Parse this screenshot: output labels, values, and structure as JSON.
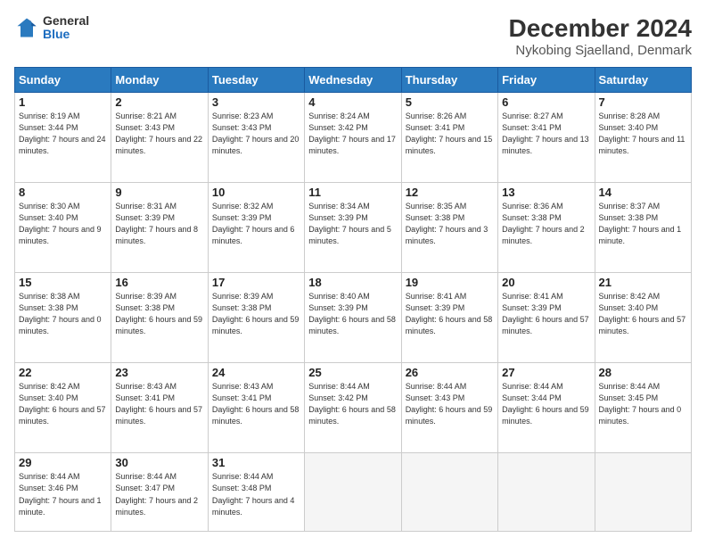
{
  "logo": {
    "general": "General",
    "blue": "Blue"
  },
  "title": "December 2024",
  "location": "Nykobing Sjaelland, Denmark",
  "headers": [
    "Sunday",
    "Monday",
    "Tuesday",
    "Wednesday",
    "Thursday",
    "Friday",
    "Saturday"
  ],
  "weeks": [
    [
      {
        "day": "1",
        "sunrise": "8:19 AM",
        "sunset": "3:44 PM",
        "daylight": "7 hours and 24 minutes."
      },
      {
        "day": "2",
        "sunrise": "8:21 AM",
        "sunset": "3:43 PM",
        "daylight": "7 hours and 22 minutes."
      },
      {
        "day": "3",
        "sunrise": "8:23 AM",
        "sunset": "3:43 PM",
        "daylight": "7 hours and 20 minutes."
      },
      {
        "day": "4",
        "sunrise": "8:24 AM",
        "sunset": "3:42 PM",
        "daylight": "7 hours and 17 minutes."
      },
      {
        "day": "5",
        "sunrise": "8:26 AM",
        "sunset": "3:41 PM",
        "daylight": "7 hours and 15 minutes."
      },
      {
        "day": "6",
        "sunrise": "8:27 AM",
        "sunset": "3:41 PM",
        "daylight": "7 hours and 13 minutes."
      },
      {
        "day": "7",
        "sunrise": "8:28 AM",
        "sunset": "3:40 PM",
        "daylight": "7 hours and 11 minutes."
      }
    ],
    [
      {
        "day": "8",
        "sunrise": "8:30 AM",
        "sunset": "3:40 PM",
        "daylight": "7 hours and 9 minutes."
      },
      {
        "day": "9",
        "sunrise": "8:31 AM",
        "sunset": "3:39 PM",
        "daylight": "7 hours and 8 minutes."
      },
      {
        "day": "10",
        "sunrise": "8:32 AM",
        "sunset": "3:39 PM",
        "daylight": "7 hours and 6 minutes."
      },
      {
        "day": "11",
        "sunrise": "8:34 AM",
        "sunset": "3:39 PM",
        "daylight": "7 hours and 5 minutes."
      },
      {
        "day": "12",
        "sunrise": "8:35 AM",
        "sunset": "3:38 PM",
        "daylight": "7 hours and 3 minutes."
      },
      {
        "day": "13",
        "sunrise": "8:36 AM",
        "sunset": "3:38 PM",
        "daylight": "7 hours and 2 minutes."
      },
      {
        "day": "14",
        "sunrise": "8:37 AM",
        "sunset": "3:38 PM",
        "daylight": "7 hours and 1 minute."
      }
    ],
    [
      {
        "day": "15",
        "sunrise": "8:38 AM",
        "sunset": "3:38 PM",
        "daylight": "7 hours and 0 minutes."
      },
      {
        "day": "16",
        "sunrise": "8:39 AM",
        "sunset": "3:38 PM",
        "daylight": "6 hours and 59 minutes."
      },
      {
        "day": "17",
        "sunrise": "8:39 AM",
        "sunset": "3:38 PM",
        "daylight": "6 hours and 59 minutes."
      },
      {
        "day": "18",
        "sunrise": "8:40 AM",
        "sunset": "3:39 PM",
        "daylight": "6 hours and 58 minutes."
      },
      {
        "day": "19",
        "sunrise": "8:41 AM",
        "sunset": "3:39 PM",
        "daylight": "6 hours and 58 minutes."
      },
      {
        "day": "20",
        "sunrise": "8:41 AM",
        "sunset": "3:39 PM",
        "daylight": "6 hours and 57 minutes."
      },
      {
        "day": "21",
        "sunrise": "8:42 AM",
        "sunset": "3:40 PM",
        "daylight": "6 hours and 57 minutes."
      }
    ],
    [
      {
        "day": "22",
        "sunrise": "8:42 AM",
        "sunset": "3:40 PM",
        "daylight": "6 hours and 57 minutes."
      },
      {
        "day": "23",
        "sunrise": "8:43 AM",
        "sunset": "3:41 PM",
        "daylight": "6 hours and 57 minutes."
      },
      {
        "day": "24",
        "sunrise": "8:43 AM",
        "sunset": "3:41 PM",
        "daylight": "6 hours and 58 minutes."
      },
      {
        "day": "25",
        "sunrise": "8:44 AM",
        "sunset": "3:42 PM",
        "daylight": "6 hours and 58 minutes."
      },
      {
        "day": "26",
        "sunrise": "8:44 AM",
        "sunset": "3:43 PM",
        "daylight": "6 hours and 59 minutes."
      },
      {
        "day": "27",
        "sunrise": "8:44 AM",
        "sunset": "3:44 PM",
        "daylight": "6 hours and 59 minutes."
      },
      {
        "day": "28",
        "sunrise": "8:44 AM",
        "sunset": "3:45 PM",
        "daylight": "7 hours and 0 minutes."
      }
    ],
    [
      {
        "day": "29",
        "sunrise": "8:44 AM",
        "sunset": "3:46 PM",
        "daylight": "7 hours and 1 minute."
      },
      {
        "day": "30",
        "sunrise": "8:44 AM",
        "sunset": "3:47 PM",
        "daylight": "7 hours and 2 minutes."
      },
      {
        "day": "31",
        "sunrise": "8:44 AM",
        "sunset": "3:48 PM",
        "daylight": "7 hours and 4 minutes."
      },
      null,
      null,
      null,
      null
    ]
  ]
}
